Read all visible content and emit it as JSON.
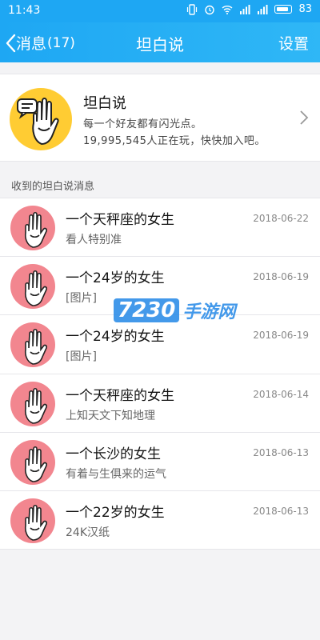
{
  "status": {
    "time": "11:43",
    "battery": "83"
  },
  "nav": {
    "back_label": "消息",
    "back_count": "(17)",
    "title": "坦白说",
    "right_label": "设置"
  },
  "intro": {
    "title": "坦白说",
    "line1": "每一个好友都有闪光点。",
    "line2": "19,995,545人正在玩，快快加入吧。"
  },
  "section_label": "收到的坦白说消息",
  "messages": [
    {
      "name": "一个天秤座的女生",
      "sub": "看人特别准",
      "date": "2018-06-22"
    },
    {
      "name": "一个24岁的女生",
      "sub": "[图片]",
      "date": "2018-06-19"
    },
    {
      "name": "一个24岁的女生",
      "sub": "[图片]",
      "date": "2018-06-19"
    },
    {
      "name": "一个天秤座的女生",
      "sub": "上知天文下知地理",
      "date": "2018-06-14"
    },
    {
      "name": "一个长沙的女生",
      "sub": "有着与生俱来的运气",
      "date": "2018-06-13"
    },
    {
      "name": "一个22岁的女生",
      "sub": "24K汉纸",
      "date": "2018-06-13"
    }
  ],
  "watermark": {
    "num": "7230",
    "text": "手游网"
  },
  "colors": {
    "nav_blue": "#1ea7f3",
    "avatar_pink": "#f2868f",
    "logo_yellow": "#ffcc33"
  }
}
